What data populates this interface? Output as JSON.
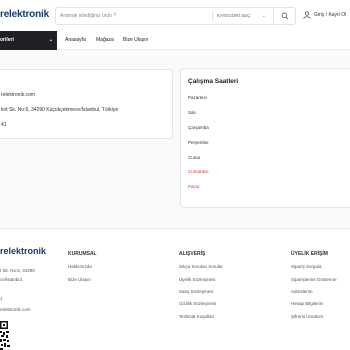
{
  "header": {
    "logo": "relektronik",
    "search_placeholder": "Aramak istediğiniz ürün ?",
    "category_select": "KATEGORİ SEÇ",
    "user_label": "Giriş / Kayıt Ol"
  },
  "nav": {
    "categories_label": "orileri",
    "links": [
      "Anasayfa",
      "Mağaza",
      "Bize Ulaşın"
    ]
  },
  "contact": {
    "email": "relektronik.com",
    "address": "kirt Sk. No:6, 34290 Küçükçekmece/İstanbul, Türkiye",
    "phone": "41"
  },
  "hours": {
    "title": "Çalışma Saatleri",
    "days": [
      {
        "label": "Pazartesi",
        "closed": false
      },
      {
        "label": "Salı",
        "closed": false
      },
      {
        "label": "Çarşamba",
        "closed": false
      },
      {
        "label": "Perşembe",
        "closed": false
      },
      {
        "label": "Cuma",
        "closed": false
      },
      {
        "label": "Cumartesi",
        "closed": true
      },
      {
        "label": "Pazar",
        "closed": true
      }
    ]
  },
  "footer": {
    "logo": "relektronik",
    "address_line1": "t Sk. No:6, 34290",
    "address_line2": "ce/İstanbul,",
    "phone": "1",
    "email": "relektronik.com",
    "columns": [
      {
        "title": "KURUMSAL",
        "links": [
          "Hakkımızda",
          "Bize Ulaşın"
        ]
      },
      {
        "title": "ALIŞVERİŞ",
        "links": [
          "Sıkça Sorulan Sorular",
          "Üyelik Sözleşmesi",
          "Satış Sözleşmesi",
          "Gizlilik Sözleşmesi",
          "Teslimat Koşulları"
        ]
      },
      {
        "title": "ÜYELİK ERİŞİM",
        "links": [
          "Sipariş Sorgula",
          "Siparişlerimi Gösterme",
          "Adreslerim",
          "Hesap Bilgilerim",
          "Şifremi Unuttum"
        ]
      }
    ]
  },
  "icons": {
    "search": "search-icon",
    "user": "user-icon",
    "chevron": "chevron-down-icon",
    "qr": "qr-code-icon"
  },
  "colors": {
    "brand": "#1a3a6b",
    "nav_dark": "#1f1f24",
    "closed_day": "#d2402f"
  }
}
